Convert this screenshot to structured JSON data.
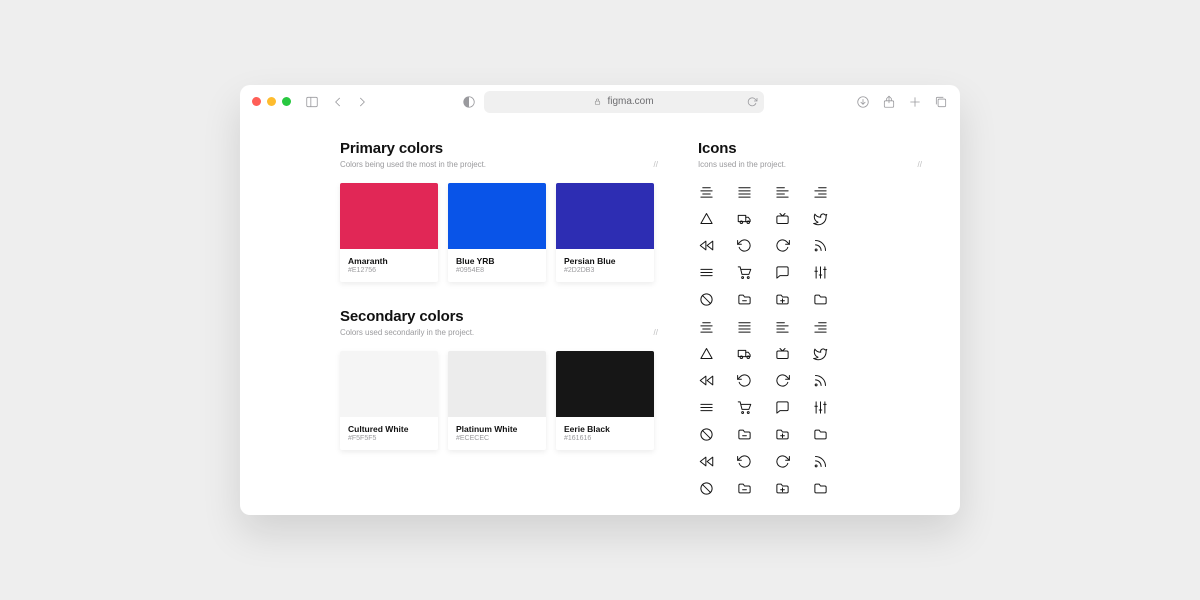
{
  "browser": {
    "url_display": "figma.com"
  },
  "primary": {
    "title": "Primary colors",
    "subtitle": "Colors being used the most in the project.",
    "marker": "//",
    "swatches": [
      {
        "name": "Amaranth",
        "hex": "#E12756",
        "color": "#E12756"
      },
      {
        "name": "Blue YRB",
        "hex": "#0954E8",
        "color": "#0954E8"
      },
      {
        "name": "Persian Blue",
        "hex": "#2D2DB3",
        "color": "#2D2DB3"
      }
    ]
  },
  "secondary": {
    "title": "Secondary colors",
    "subtitle": "Colors used secondarily in the project.",
    "marker": "//",
    "swatches": [
      {
        "name": "Cultured White",
        "hex": "#F5F5F5",
        "color": "#F5F5F5"
      },
      {
        "name": "Platinum White",
        "hex": "#ECECEC",
        "color": "#ECECEC"
      },
      {
        "name": "Eerie Black",
        "hex": "#161616",
        "color": "#161616"
      }
    ]
  },
  "icons": {
    "title": "Icons",
    "subtitle": "Icons used in the project.",
    "marker": "//",
    "grid": [
      "align-center",
      "align-justify",
      "align-left",
      "align-right",
      "triangle",
      "truck",
      "tv",
      "twitter",
      "rewind",
      "rotate-ccw",
      "rotate-cw",
      "rss",
      "menu",
      "shopping-cart",
      "message-square",
      "sliders",
      "slash-circle",
      "folder-minus",
      "folder-plus",
      "folder",
      "align-center",
      "align-justify",
      "align-left",
      "align-right",
      "triangle",
      "truck",
      "tv",
      "twitter",
      "rewind",
      "rotate-ccw",
      "rotate-cw",
      "rss",
      "menu",
      "shopping-cart",
      "message-square",
      "sliders",
      "slash-circle",
      "folder-minus",
      "folder-plus",
      "folder",
      "rewind",
      "rotate-ccw",
      "rotate-cw",
      "rss",
      "slash-circle",
      "folder-minus",
      "folder-plus",
      "folder"
    ]
  }
}
